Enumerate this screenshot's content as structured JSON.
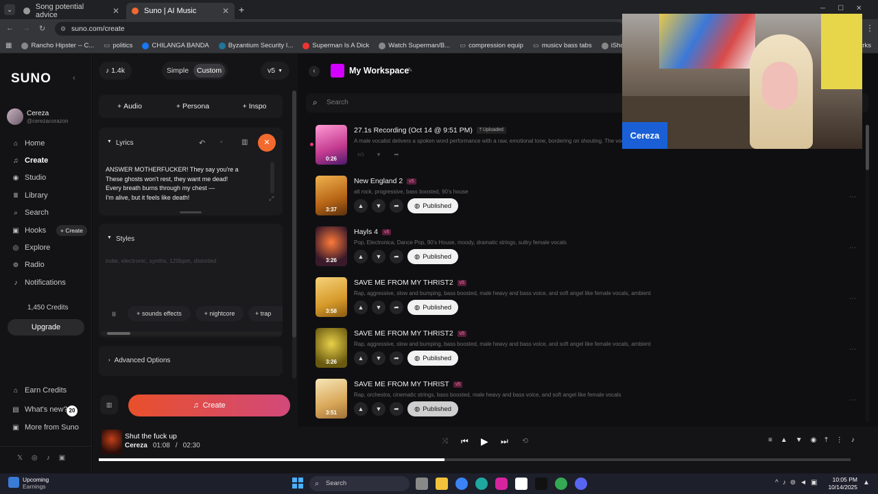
{
  "browser": {
    "tabs": [
      {
        "label": "Song potential advice"
      },
      {
        "label": "Suno | AI Music"
      }
    ],
    "url": "suno.com/create",
    "bookmarks": [
      "Rancho Hipster -- C...",
      "politics",
      "CHILANGA BANDA",
      "Byzantium Security I...",
      "Superman Is A Dick",
      "Watch Superman/B...",
      "compression equip",
      "musicv bass tabs",
      "iShoes motorized sk..."
    ],
    "bookmarks_tail": "arks"
  },
  "sidebar": {
    "logo": "SUNO",
    "user_name": "Cereza",
    "user_handle": "@cerezacorazon",
    "items": [
      {
        "label": "Home",
        "icon": "home-icon"
      },
      {
        "label": "Create",
        "icon": "create-icon"
      },
      {
        "label": "Studio",
        "icon": "studio-icon"
      },
      {
        "label": "Library",
        "icon": "library-icon"
      },
      {
        "label": "Search",
        "icon": "search-icon"
      },
      {
        "label": "Hooks",
        "icon": "hooks-icon"
      },
      {
        "label": "Explore",
        "icon": "explore-icon"
      },
      {
        "label": "Radio",
        "icon": "radio-icon"
      },
      {
        "label": "Notifications",
        "icon": "bell-icon"
      }
    ],
    "hooks_create": "+ Create",
    "credits": "1,450 Credits",
    "upgrade": "Upgrade",
    "footer": [
      {
        "label": "Earn Credits"
      },
      {
        "label": "What's new?"
      },
      {
        "label": "More from Suno"
      }
    ],
    "whats_new_badge": "20"
  },
  "create": {
    "count": "1.4k",
    "mode_simple": "Simple",
    "mode_custom": "Custom",
    "version": "v5",
    "add_audio": "Audio",
    "add_persona": "Persona",
    "add_inspo": "Inspo",
    "lyrics_label": "Lyrics",
    "lyrics": [
      "ANSWER MOTHERFUCKER! They say you're a",
      "These ghosts won't rest, they want me dead!",
      "Every breath burns through my chest —",
      "I'm alive, but it feels like death!"
    ],
    "styles_label": "Styles",
    "styles_placeholder": "indie, electronic, synths, 120bpm, distorted",
    "style_tags": [
      "sounds effects",
      "nightcore",
      "trap"
    ],
    "advanced": "Advanced Options",
    "create_button": "Create"
  },
  "workspace": {
    "title": "My Workspace",
    "search_placeholder": "Search",
    "songs": [
      {
        "title": "27.1s Recording (Oct 14 @ 9:51 PM)",
        "badge": "Uploaded",
        "desc": "A male vocalist delivers a spoken word performance with a raw, emotional tone, bordering on shouting. The vocal de",
        "length": "0:26",
        "published": ""
      },
      {
        "title": "New England 2",
        "badge": "v5",
        "desc": "alt rock, progressive, bass boosted, 90's house",
        "length": "3:37",
        "published": "Published"
      },
      {
        "title": "Hayls 4",
        "badge": "v5",
        "desc": "Pop, Electronica, Dance Pop, 90's House, moody, dramatic strings, sultry female vocals",
        "length": "3:26",
        "published": "Published"
      },
      {
        "title": "SAVE ME FROM MY THRIST2",
        "badge": "v5",
        "desc": "Rap, aggressive, slow and bumping, bass boosted, male heavy and bass voice, and soft angel like female vocals, ambient",
        "length": "3:58",
        "published": "Published"
      },
      {
        "title": "SAVE ME FROM MY THRIST2",
        "badge": "v5",
        "desc": "Rap, aggressive, slow and bumping, bass boosted, male heavy and bass voice, and soft angel like female vocals, ambient",
        "length": "3:26",
        "published": "Published"
      },
      {
        "title": "SAVE ME FROM MY THRIST",
        "badge": "v5",
        "desc": "Rap, orchestra, cinematic strings, bass boosted, male heavy and bass voice, and soft angel like female vocals",
        "length": "3:51",
        "published": "Published"
      }
    ]
  },
  "player": {
    "title": "Shut the fuck up",
    "artist": "Cereza",
    "time": "01:08",
    "sep": "/",
    "duration": "02:30",
    "progress": 0.46
  },
  "webcam": {
    "name": "Cereza"
  },
  "taskbar": {
    "notice_title": "Upcoming",
    "notice_sub": "Earnings",
    "search": "Search",
    "time": "10:05 PM",
    "date": "10/14/2025"
  },
  "colors": {
    "accent": "#f26a2e",
    "create_grad_start": "#e8502b",
    "create_grad_end": "#c44b8a",
    "workspace_icon": "#d400ff"
  }
}
